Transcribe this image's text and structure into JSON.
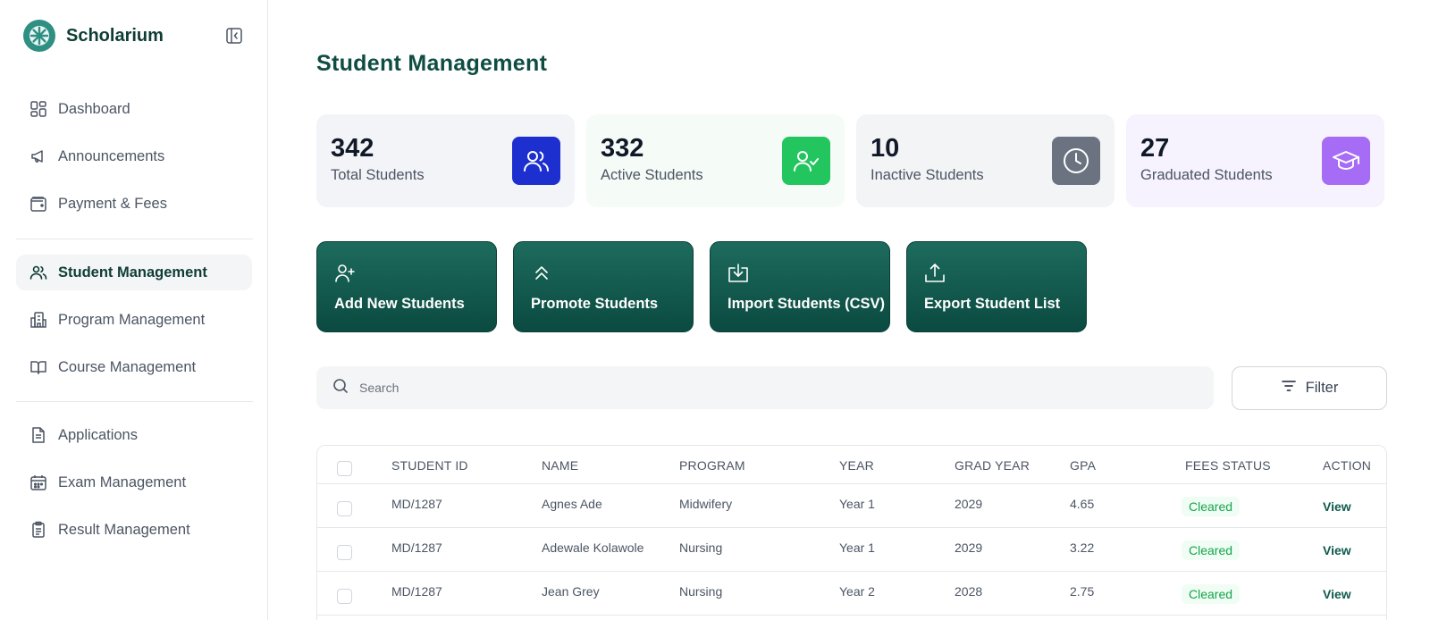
{
  "app": {
    "name": "Scholarium"
  },
  "colors": {
    "brand": "#0f4d43",
    "accent": "#2f8f83",
    "total": "#1d2fcf",
    "active": "#22c55e",
    "inactive": "#6b7280",
    "graduated": "#a66cf5"
  },
  "sidebar": {
    "group1": [
      {
        "label": "Dashboard",
        "icon": "dashboard-icon"
      },
      {
        "label": "Announcements",
        "icon": "megaphone-icon"
      },
      {
        "label": "Payment & Fees",
        "icon": "wallet-icon"
      }
    ],
    "group2": [
      {
        "label": "Student Management",
        "icon": "users-icon",
        "active": true
      },
      {
        "label": "Program Management",
        "icon": "building-icon"
      },
      {
        "label": "Course Management",
        "icon": "book-icon"
      }
    ],
    "group3": [
      {
        "label": "Applications",
        "icon": "document-icon"
      },
      {
        "label": "Exam Management",
        "icon": "calendar-icon"
      },
      {
        "label": "Result Management",
        "icon": "clipboard-icon"
      }
    ]
  },
  "main": {
    "title": "Student Management",
    "stats": [
      {
        "value": "342",
        "label": "Total Students",
        "icon": "users-icon"
      },
      {
        "value": "332",
        "label": "Active Students",
        "icon": "user-check-icon"
      },
      {
        "value": "10",
        "label": "Inactive Students",
        "icon": "clock-icon"
      },
      {
        "value": "27",
        "label": "Graduated Students",
        "icon": "graduation-cap-icon"
      }
    ],
    "actions": [
      {
        "label": "Add New Students",
        "icon": "user-plus-icon"
      },
      {
        "label": "Promote Students",
        "icon": "chevrons-up-icon"
      },
      {
        "label": "Import Students (CSV)",
        "icon": "import-icon"
      },
      {
        "label": "Export Student List",
        "icon": "upload-icon"
      }
    ],
    "search": {
      "placeholder": "Search"
    },
    "filter": {
      "label": "Filter"
    },
    "table": {
      "columns": [
        "STUDENT ID",
        "NAME",
        "PROGRAM",
        "YEAR",
        "GRAD YEAR",
        "GPA",
        "FEES STATUS",
        "ACTION"
      ],
      "rows": [
        {
          "id": "MD/1287",
          "name": "Agnes Ade",
          "program": "Midwifery",
          "year": "Year 1",
          "grad": "2029",
          "gpa": "4.65",
          "status": "Cleared",
          "action": "View"
        },
        {
          "id": "MD/1287",
          "name": "Adewale Kolawole",
          "program": "Nursing",
          "year": "Year 1",
          "grad": "2029",
          "gpa": "3.22",
          "status": "Cleared",
          "action": "View"
        },
        {
          "id": "MD/1287",
          "name": "Jean Grey",
          "program": "Nursing",
          "year": "Year 2",
          "grad": "2028",
          "gpa": "2.75",
          "status": "Cleared",
          "action": "View"
        }
      ]
    }
  }
}
